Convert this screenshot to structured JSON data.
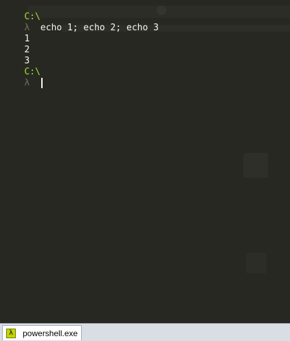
{
  "terminal": {
    "lines": [
      {
        "path": "C:\\"
      },
      {
        "prompt": "λ",
        "command": "echo 1; echo 2; echo 3"
      },
      {
        "output": "1"
      },
      {
        "output": "2"
      },
      {
        "output": "3"
      },
      {
        "path": "C:\\"
      },
      {
        "prompt": "λ",
        "command": ""
      }
    ]
  },
  "tabbar": {
    "tabs": [
      {
        "icon": "lambda-icon",
        "icon_glyph": "λ",
        "label": "powershell.exe",
        "active": true
      }
    ]
  },
  "colors": {
    "background": "#272822",
    "path": "#a6e22e",
    "prompt": "#75715e",
    "text": "#f8f8f2",
    "tab_icon": "#c3d600"
  }
}
